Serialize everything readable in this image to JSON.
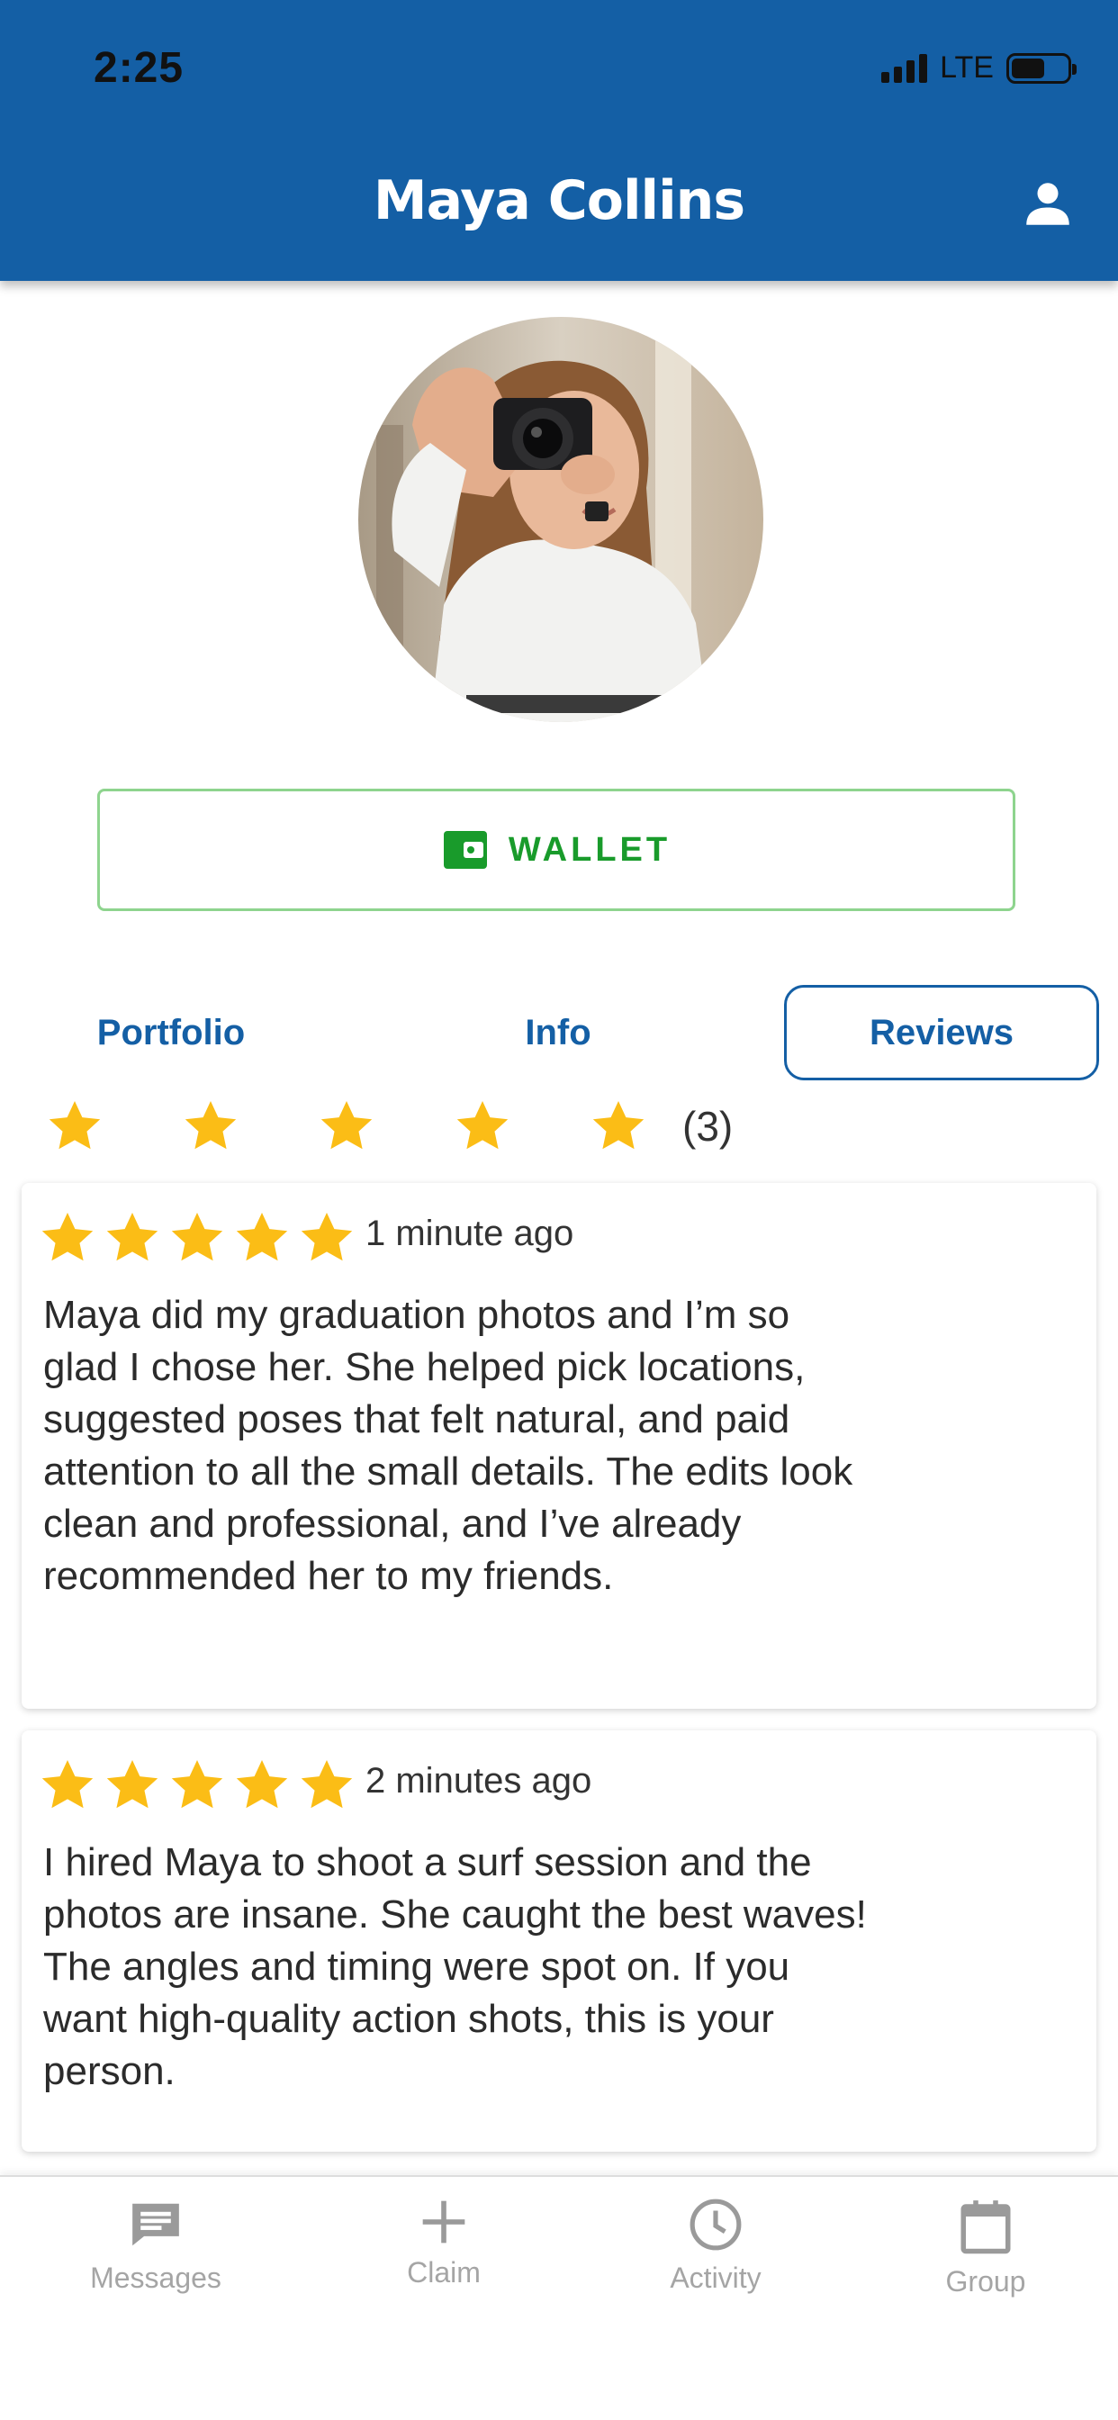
{
  "status_bar": {
    "time": "2:25",
    "network": "LTE"
  },
  "header": {
    "title": "Maya Collins",
    "profile_icon": "person-icon"
  },
  "wallet": {
    "label": "WALLET",
    "icon": "wallet-icon",
    "color": "#199b2b"
  },
  "tabs": [
    {
      "label": "Portfolio",
      "active": false
    },
    {
      "label": "Info",
      "active": false
    },
    {
      "label": "Reviews",
      "active": true
    }
  ],
  "rating_summary": {
    "stars": 5,
    "count": "(3)"
  },
  "reviews": [
    {
      "stars": 5,
      "time": "1 minute ago",
      "text": "Maya did my graduation photos and I’m so glad I chose her. She helped pick locations, suggested poses that felt natural, and paid attention to all the small details. The edits look clean and professional, and I’ve already recommended her to my friends."
    },
    {
      "stars": 5,
      "time": "2 minutes ago",
      "text": "I hired Maya to shoot a surf session and the photos are insane. She caught the best waves! The angles and timing were spot on. If you want high-quality action shots, this is your person."
    }
  ],
  "bottom_nav": [
    {
      "label": "Messages",
      "icon": "message-icon"
    },
    {
      "label": "Claim",
      "icon": "plus-icon"
    },
    {
      "label": "Activity",
      "icon": "clock-icon"
    },
    {
      "label": "Group",
      "icon": "calendar-icon"
    }
  ],
  "colors": {
    "primary": "#145fa5",
    "star": "#fbbd16",
    "wallet_border": "#8ed48e"
  }
}
